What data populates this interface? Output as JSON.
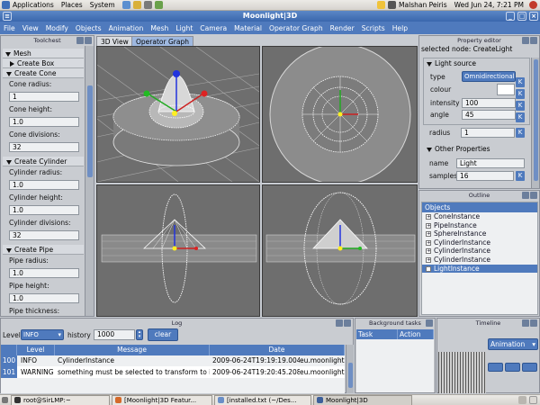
{
  "panel": {
    "menus": [
      "Applications",
      "Places",
      "System"
    ],
    "user": "Malshan Peiris",
    "clock": "Wed Jun 24,  7:21 PM"
  },
  "window": {
    "title": "Moonlight|3D"
  },
  "menubar": [
    "File",
    "View",
    "Modify",
    "Objects",
    "Animation",
    "Mesh",
    "Light",
    "Camera",
    "Material",
    "Operator Graph",
    "Render",
    "Scripts",
    "Help"
  ],
  "toolchest": {
    "title": "Toolchest",
    "mesh_label": "Mesh",
    "create_box": "Create Box",
    "create_cone": "Create Cone",
    "cone": {
      "radius_label": "Cone radius:",
      "radius": "1",
      "height_label": "Cone height:",
      "height": "1.0",
      "div_label": "Cone divisions:",
      "div": "32"
    },
    "create_cylinder": "Create Cylinder",
    "cylinder": {
      "radius_label": "Cylinder radius:",
      "radius": "1.0",
      "height_label": "Cylinder height:",
      "height": "1.0",
      "div_label": "Cylinder divisions:",
      "div": "32"
    },
    "create_pipe": "Create Pipe",
    "pipe": {
      "radius_label": "Pipe radius:",
      "radius": "1.0",
      "height_label": "Pipe height:",
      "height": "1.0",
      "thick_label": "Pipe thickness:"
    }
  },
  "tabs": [
    "3D View",
    "Operator Graph"
  ],
  "property_editor": {
    "title": "Property editor",
    "selected": "selected node: CreateLight",
    "light_source": "Light source",
    "type_label": "type",
    "type_value": "Omnidirectional",
    "colour_label": "colour",
    "intensity_label": "intensity",
    "intensity": "100",
    "angle_label": "angle",
    "angle": "45",
    "radius_label": "radius",
    "radius": "1",
    "other_props": "Other Properties",
    "name_label": "name",
    "name": "Light",
    "samples_label": "samples",
    "samples": "16",
    "k": "K"
  },
  "outline": {
    "title": "Outline",
    "header": "Objects",
    "items": [
      "ConeInstance",
      "PipeInstance",
      "SphereInstance",
      "CylinderInstance",
      "CylinderInstance",
      "CylinderInstance",
      "LightInstance"
    ]
  },
  "log": {
    "title": "Log",
    "level_label": "Level",
    "level_value": "INFO",
    "history_label": "history",
    "history_value": "1000",
    "clear": "clear",
    "columns": [
      "Level",
      "Message",
      "Date"
    ],
    "rows": [
      {
        "num": "100",
        "level": "INFO",
        "msg": "CylinderInstance",
        "date": "2009-06-24T19:19:19.004",
        "src": "eu.moonlight"
      },
      {
        "num": "101",
        "level": "WARNING",
        "msg": "something must be selected to transform to it",
        "date": "2009-06-24T19:20:45.208",
        "src": "eu.moonlight"
      }
    ]
  },
  "background_tasks": {
    "title": "Background tasks",
    "columns": [
      "Task",
      "Action"
    ]
  },
  "timeline": {
    "title": "Timeline",
    "mode": "Animation"
  },
  "taskbar": [
    "root@SirLMP:~",
    "[Moonlight|3D Featur...",
    "[installed.txt (~/Des...",
    "Moonlight|3D"
  ],
  "colors": {
    "accent": "#4f7abd",
    "menubar": "#4f7abd",
    "titlebar": "#3a67ad",
    "viewport": "#6e6e6e",
    "selected": "#4f7abd"
  }
}
